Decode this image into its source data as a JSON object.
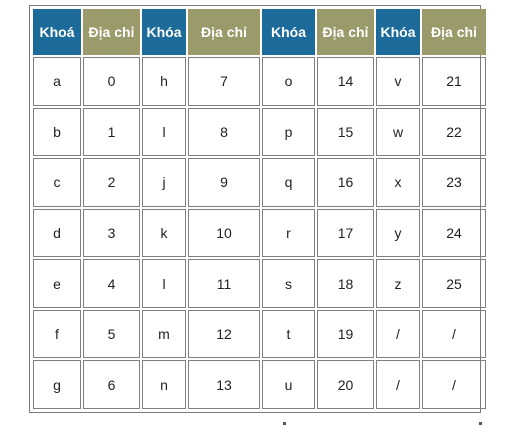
{
  "table": {
    "headers": [
      "Khoá",
      "Địa chỉ",
      "Khóa",
      "Địa chỉ",
      "Khóa",
      "Địa chỉ",
      "Khóa",
      "Địa chỉ"
    ],
    "header_colors": {
      "key": "#1c6b9b",
      "address": "#9b9a6a"
    },
    "rows": [
      [
        "a",
        "0",
        "h",
        "7",
        "o",
        "14",
        "v",
        "21"
      ],
      [
        "b",
        "1",
        "l",
        "8",
        "p",
        "15",
        "w",
        "22"
      ],
      [
        "c",
        "2",
        "j",
        "9",
        "q",
        "16",
        "x",
        "23"
      ],
      [
        "d",
        "3",
        "k",
        "10",
        "r",
        "17",
        "y",
        "24"
      ],
      [
        "e",
        "4",
        "l",
        "11",
        "s",
        "18",
        "z",
        "25"
      ],
      [
        "f",
        "5",
        "m",
        "12",
        "t",
        "19",
        "/",
        "/"
      ],
      [
        "g",
        "6",
        "n",
        "13",
        "u",
        "20",
        "/",
        "/"
      ]
    ]
  }
}
